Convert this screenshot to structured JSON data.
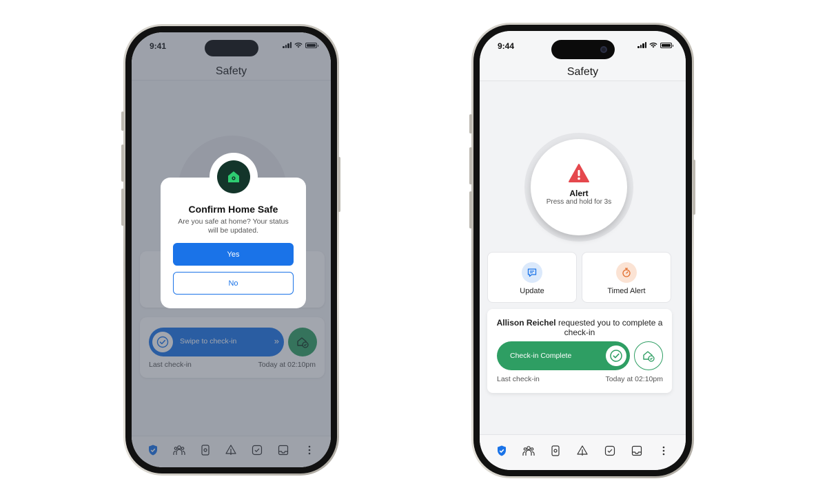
{
  "left_phone": {
    "status_time": "9:41",
    "title": "Safety",
    "modal": {
      "title": "Confirm Home Safe",
      "body": "Are you safe at home? Your status will be updated.",
      "yes_label": "Yes",
      "no_label": "No",
      "icon": "home-shield-icon"
    },
    "swipe": {
      "label": "Swipe to check-in",
      "chevrons": "»"
    },
    "last_checkin_label": "Last check-in",
    "last_checkin_value": "Today at 02:10pm"
  },
  "right_phone": {
    "status_time": "9:44",
    "title": "Safety",
    "alert": {
      "title": "Alert",
      "subtitle": "Press and hold for 3s",
      "icon": "warning-triangle-icon",
      "color": "#e5484d"
    },
    "actions": [
      {
        "label": "Update",
        "icon": "message-icon",
        "color": "#1a73e8"
      },
      {
        "label": "Timed Alert",
        "icon": "stopwatch-icon",
        "color": "#e26d2c"
      }
    ],
    "request": {
      "requester": "Allison Reichel",
      "text": " requested you to complete a check-in",
      "button_label": "Check-in Complete",
      "last_checkin_label": "Last check-in",
      "last_checkin_value": "Today at 02:10pm"
    }
  },
  "tab_bar": {
    "tabs": [
      "shield-icon",
      "people-icon",
      "device-icon",
      "tree-icon",
      "checkbox-icon",
      "inbox-icon",
      "more-vertical-icon"
    ],
    "active_index": 0
  },
  "colors": {
    "accent_blue": "#1a73e8",
    "success_green": "#2e9e63",
    "alert_red": "#e5484d"
  }
}
